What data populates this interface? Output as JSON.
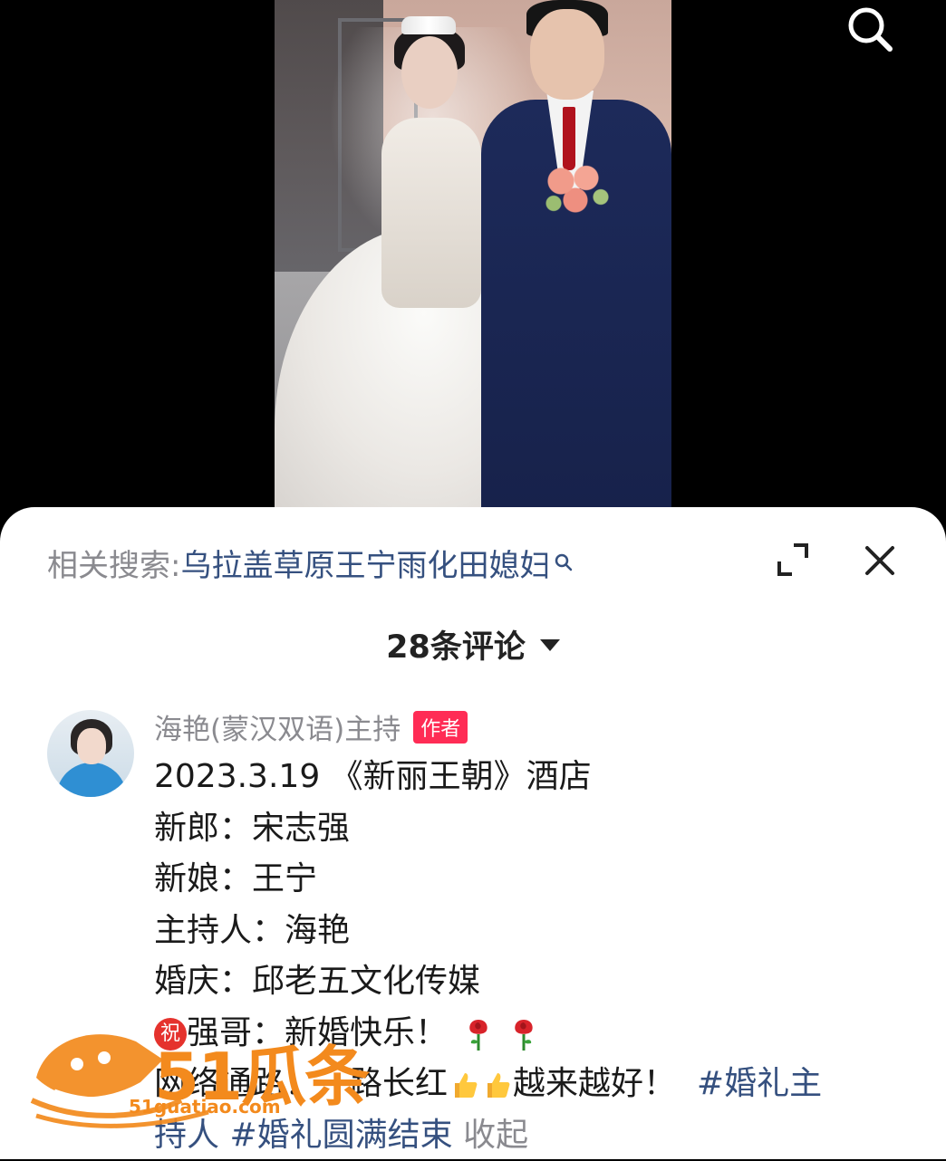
{
  "related": {
    "label": "相关搜索:",
    "query": "乌拉盖草原王宁雨化田媳妇"
  },
  "comments": {
    "count_label": "28条评论"
  },
  "comment": {
    "author": "海艳(蒙汉双语)主持",
    "badge": "作者",
    "lines": [
      "2023.3.19 《新丽王朝》酒店",
      "新郎：宋志强",
      "新娘：王宁",
      "主持人：海艳",
      "婚庆：邱老五文化传媒"
    ],
    "line6": "强哥：新婚快乐！",
    "line7a": "网络通路！一路长红",
    "line7b": "越来越好！",
    "tag1_part1": "#婚礼主",
    "tag1_part2": "持人",
    "tag2": "#婚礼圆满结束",
    "collapse": "收起"
  },
  "watermark": {
    "brand": "51瓜条",
    "url": "51guatiao.com"
  },
  "icons": {
    "search": "search-icon",
    "expand": "expand-icon",
    "close": "close-icon"
  },
  "colors": {
    "link": "#35507f",
    "badge": "#ff2c55",
    "watermark": "#f38a1d"
  }
}
